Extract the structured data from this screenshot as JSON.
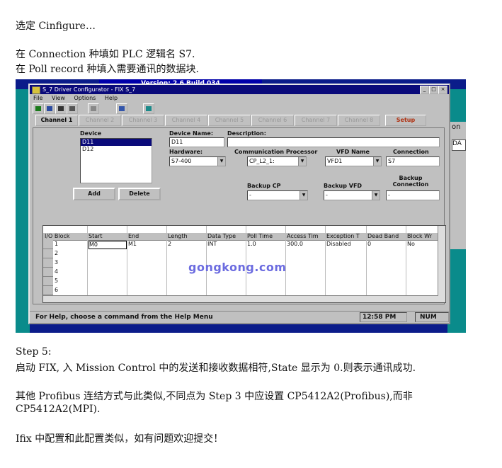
{
  "doc": {
    "line1": "选定 Cinfigure…",
    "line2": "在 Connection 种填如 PLC 逻辑名 S7.",
    "line3": "在 Poll record 种填入需要通讯的数据块.",
    "step": "Step 5:",
    "step_text": "启动 FIX, 入 Mission Control 中的发送和接收数据相符,State 显示为 0.则表示通讯成功.",
    "other1": "其他 Profibus 连结方式与此类似,不同点为 Step 3 中应设置 CP5412A2(Profibus),而非",
    "other2": "CP5412A2(MPI).",
    "last": "Ifix 中配置和此配置类似，如有问题欢迎提交！"
  },
  "bg": {
    "version_bar": "Version: 2.6 Build 034",
    "right_glyph": "on",
    "right_field": "DA"
  },
  "window": {
    "title": "S_7 Driver Configurator - FIX S_7",
    "menu": [
      "File",
      "View",
      "Options",
      "Help"
    ],
    "tabs": [
      "Channel 1",
      "Channel 2",
      "Channel 3",
      "Channel 4",
      "Channel 5",
      "Channel 6",
      "Channel 7",
      "Channel 8",
      "Setup"
    ],
    "device_label": "Device",
    "devices": [
      "D11",
      "D12"
    ],
    "add": "Add",
    "delete": "Delete",
    "device_name_label": "Device Name:",
    "device_name": "D11",
    "description_label": "Description:",
    "description": "",
    "hardware_label": "Hardware:",
    "hardware": "S7-400",
    "cp_label": "Communication Processor",
    "cp": "CP_L2_1:",
    "vfd_label": "VFD Name",
    "vfd": "VFD1",
    "connection_label": "Connection",
    "connection": "S7",
    "backup_cp_label": "Backup CP",
    "backup_cp": "-",
    "backup_vfd_label": "Backup VFD",
    "backup_vfd": "-",
    "backup_conn_label": "Backup Connection",
    "backup_conn": "-",
    "grid": {
      "columns": [
        "I/O Block",
        "Start",
        "End",
        "Length",
        "Data Type",
        "Poll Time",
        "Access Tim",
        "Exception T",
        "Dead Band",
        "Block Wr"
      ],
      "rows": [
        [
          "1",
          "M0",
          "M1",
          "2",
          "INT",
          "1.0",
          "300.0",
          "Disabled",
          "0",
          "No"
        ],
        [
          "2",
          "",
          "",
          "",
          "",
          "",
          "",
          "",
          "",
          ""
        ],
        [
          "3",
          "",
          "",
          "",
          "",
          "",
          "",
          "",
          "",
          ""
        ],
        [
          "4",
          "",
          "",
          "",
          "",
          "",
          "",
          "",
          "",
          ""
        ],
        [
          "5",
          "",
          "",
          "",
          "",
          "",
          "",
          "",
          "",
          ""
        ],
        [
          "6",
          "",
          "",
          "",
          "",
          "",
          "",
          "",
          "",
          ""
        ]
      ]
    },
    "status_help": "For Help, choose a command from the Help Menu",
    "status_time": "12:58 PM",
    "status_num": "NUM"
  },
  "watermark": "gongkong.com"
}
